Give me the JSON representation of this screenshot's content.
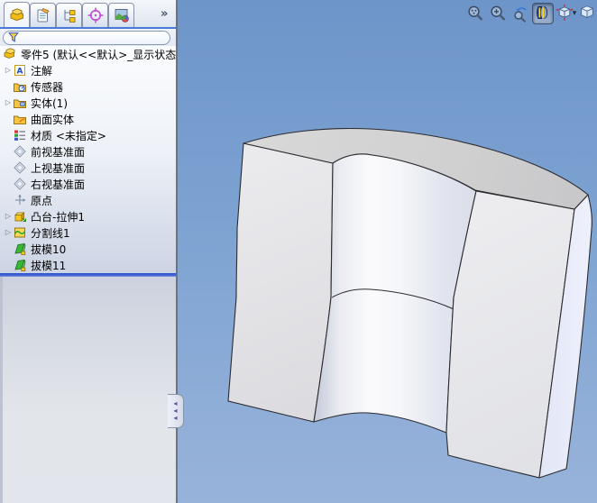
{
  "panel": {
    "tabs": [
      {
        "icon": "featuremanager-tab",
        "active": true
      },
      {
        "icon": "propertymanager-tab",
        "active": false
      },
      {
        "icon": "configurationmanager-tab",
        "active": false
      },
      {
        "icon": "dimxpert-tab",
        "active": false
      },
      {
        "icon": "displaymanager-tab",
        "active": false
      }
    ],
    "tabs_overflow_label": "»",
    "filter": {
      "value": "",
      "placeholder": ""
    },
    "tree": {
      "root_label": "零件5 (默认<<默认>_显示状态",
      "items": [
        {
          "label": "注解",
          "icon": "annotations",
          "expandable": true
        },
        {
          "label": "传感器",
          "icon": "sensors",
          "expandable": false
        },
        {
          "label": "实体(1)",
          "icon": "solid-bodies",
          "expandable": true
        },
        {
          "label": "曲面实体",
          "icon": "surface-bodies",
          "expandable": false
        },
        {
          "label": "材质 <未指定>",
          "icon": "material",
          "expandable": false
        },
        {
          "label": "前视基准面",
          "icon": "plane",
          "expandable": false
        },
        {
          "label": "上视基准面",
          "icon": "plane",
          "expandable": false
        },
        {
          "label": "右视基准面",
          "icon": "plane",
          "expandable": false
        },
        {
          "label": "原点",
          "icon": "origin",
          "expandable": false
        },
        {
          "label": "凸台-拉伸1",
          "icon": "boss-extrude",
          "expandable": true
        },
        {
          "label": "分割线1",
          "icon": "split-line",
          "expandable": true
        },
        {
          "label": "拔模10",
          "icon": "draft",
          "expandable": false
        },
        {
          "label": "拔模11",
          "icon": "draft",
          "expandable": false
        }
      ]
    }
  },
  "headsup": {
    "buttons": [
      {
        "icon": "zoom-to-fit",
        "pressed": false,
        "dropdown": false
      },
      {
        "icon": "zoom-to-area",
        "pressed": false,
        "dropdown": false
      },
      {
        "icon": "previous-view",
        "pressed": false,
        "dropdown": false
      },
      {
        "icon": "section-view",
        "pressed": true,
        "dropdown": false
      },
      {
        "icon": "view-orientation",
        "pressed": false,
        "dropdown": true
      },
      {
        "icon": "display-style",
        "pressed": false,
        "dropdown": false
      }
    ]
  },
  "colors": {
    "viewport_top": "#6e95c9",
    "viewport_bottom": "#98b3da",
    "splitter_blue": "#3a62d8",
    "tab_underline": "#4a7ad8",
    "model_top_face": "#d2d2d3",
    "model_cut_face": "#e9e9ec",
    "model_bore_highlight": "#fbfbfd"
  }
}
